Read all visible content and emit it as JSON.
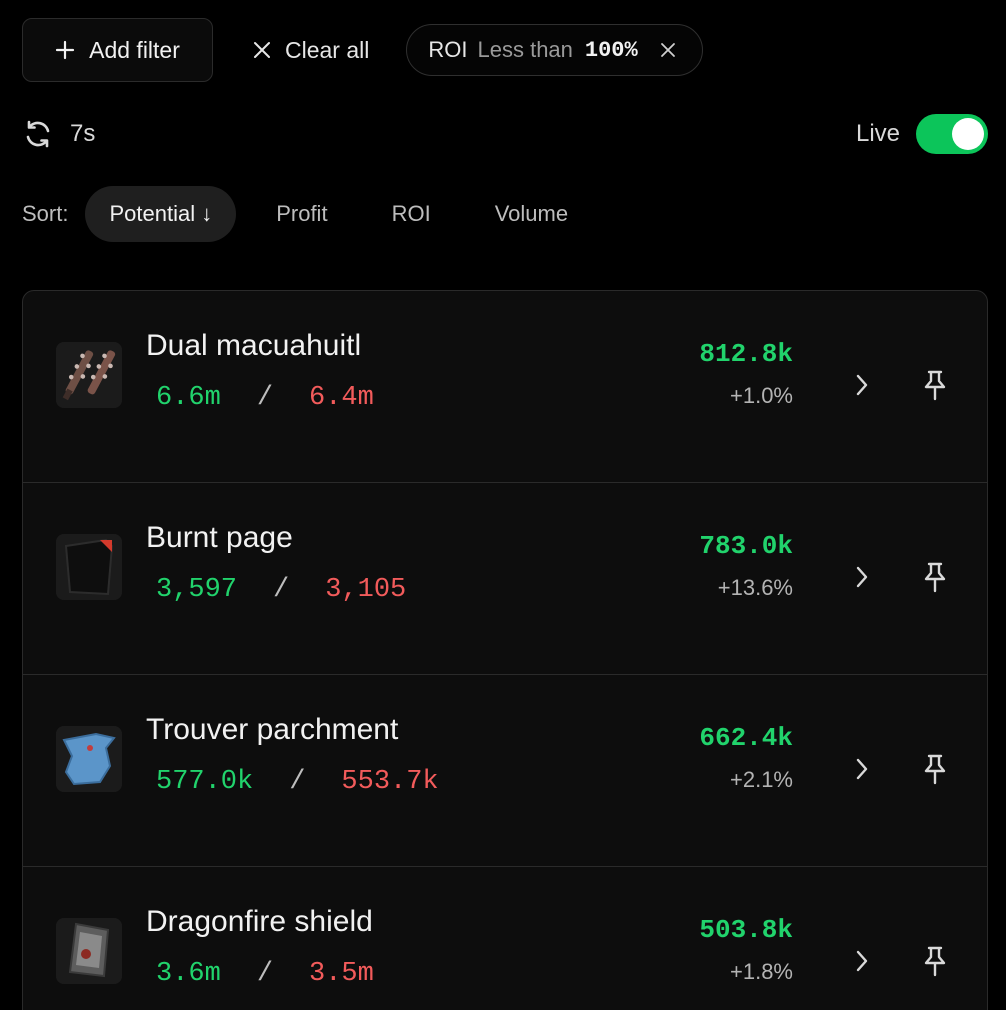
{
  "toolbar": {
    "add_filter_label": "Add filter",
    "clear_all_label": "Clear all",
    "filter_chip": {
      "field": "ROI",
      "operator": "Less than",
      "value": "100%"
    }
  },
  "status": {
    "refresh_age": "7s",
    "live_label": "Live",
    "live_enabled": true,
    "live_color": "#0cc55a"
  },
  "sort": {
    "label": "Sort:",
    "options": [
      "Potential ↓",
      "Profit",
      "ROI",
      "Volume"
    ],
    "active": "Potential ↓"
  },
  "colors": {
    "buy": "#21d36c",
    "sell": "#f25b5b"
  },
  "items": [
    {
      "name": "Dual macuahuitl",
      "buy": "6.6m",
      "separator": "/",
      "sell": "6.4m",
      "potential": "812.8k",
      "change": "+1.0%",
      "icon": "macuahuitl-icon"
    },
    {
      "name": "Burnt page",
      "buy": "3,597",
      "separator": "/",
      "sell": "3,105",
      "potential": "783.0k",
      "change": "+13.6%",
      "icon": "burnt-page-icon"
    },
    {
      "name": "Trouver parchment",
      "buy": "577.0k",
      "separator": "/",
      "sell": "553.7k",
      "potential": "662.4k",
      "change": "+2.1%",
      "icon": "parchment-icon"
    },
    {
      "name": "Dragonfire shield",
      "buy": "3.6m",
      "separator": "/",
      "sell": "3.5m",
      "potential": "503.8k",
      "change": "+1.8%",
      "icon": "dragonfire-shield-icon"
    }
  ]
}
